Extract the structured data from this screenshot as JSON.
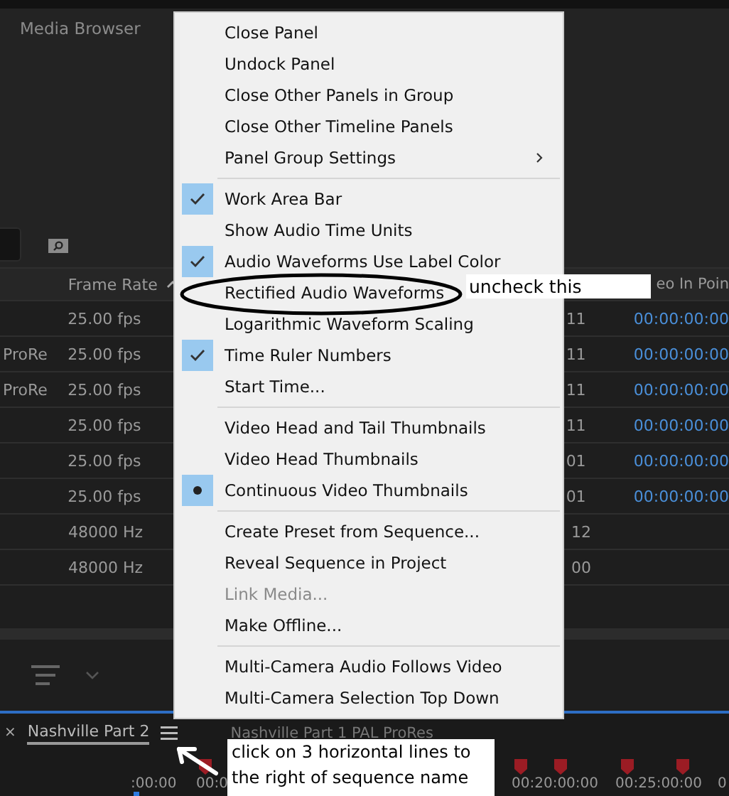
{
  "panel": {
    "title": "Media Browser"
  },
  "table": {
    "headers": {
      "frame_rate": "Frame Rate",
      "column_4": "eo In Poin"
    },
    "rows": [
      {
        "frame_rate": "25.00 fps",
        "column_3": "11",
        "column_4": "00:00:00:00"
      },
      {
        "column_1": "ProRe",
        "frame_rate": "25.00 fps",
        "column_3": "11",
        "column_4": "00:00:00:00"
      },
      {
        "column_1": "ProRe",
        "frame_rate": "25.00 fps",
        "column_3": "11",
        "column_4": "00:00:00:00"
      },
      {
        "frame_rate": "25.00 fps",
        "column_3": "11",
        "column_4": "00:00:00:00"
      },
      {
        "frame_rate": "25.00 fps",
        "column_3": "01",
        "column_4": "00:00:00:00"
      },
      {
        "frame_rate": "25.00 fps",
        "column_3": "01",
        "column_4": "00:00:00:00"
      },
      {
        "frame_rate": "48000 Hz",
        "column_3": "12"
      },
      {
        "frame_rate": "48000 Hz",
        "column_3": "00"
      }
    ]
  },
  "timeline": {
    "tab": {
      "close": "×",
      "title": "Nashville Part 2"
    },
    "sequence_name": "Nashville Part 1 PAL ProRes",
    "ruler": [
      ":00:00",
      "00:0",
      "00:20:00:00",
      "00:25:00:00",
      "0"
    ]
  },
  "menu": {
    "items": [
      {
        "kind": "action",
        "label": "Close Panel",
        "disabled": false
      },
      {
        "kind": "action",
        "label": "Undock Panel",
        "disabled": false
      },
      {
        "kind": "action",
        "label": "Close Other Panels in Group",
        "disabled": false
      },
      {
        "kind": "action",
        "label": "Close Other Timeline Panels",
        "disabled": false
      },
      {
        "kind": "submenu",
        "label": "Panel Group Settings",
        "disabled": false
      },
      {
        "kind": "separator"
      },
      {
        "kind": "check",
        "label": "Work Area Bar",
        "checked": true,
        "disabled": false
      },
      {
        "kind": "check",
        "label": "Show Audio Time Units",
        "checked": false,
        "disabled": false
      },
      {
        "kind": "check",
        "label": "Audio Waveforms Use Label Color",
        "checked": true,
        "disabled": false
      },
      {
        "kind": "check",
        "label": "Rectified Audio Waveforms",
        "checked": false,
        "disabled": false
      },
      {
        "kind": "check",
        "label": "Logarithmic Waveform Scaling",
        "checked": false,
        "disabled": false
      },
      {
        "kind": "check",
        "label": "Time Ruler Numbers",
        "checked": true,
        "disabled": false
      },
      {
        "kind": "action",
        "label": "Start Time...",
        "disabled": false
      },
      {
        "kind": "separator"
      },
      {
        "kind": "radio",
        "label": "Video Head and Tail Thumbnails",
        "selected": false,
        "disabled": false
      },
      {
        "kind": "radio",
        "label": "Video Head Thumbnails",
        "selected": false,
        "disabled": false
      },
      {
        "kind": "radio",
        "label": "Continuous Video Thumbnails",
        "selected": true,
        "disabled": false
      },
      {
        "kind": "separator"
      },
      {
        "kind": "action",
        "label": "Create Preset from Sequence...",
        "disabled": false
      },
      {
        "kind": "action",
        "label": "Reveal Sequence in Project",
        "disabled": false
      },
      {
        "kind": "action",
        "label": "Link Media...",
        "disabled": true
      },
      {
        "kind": "action",
        "label": "Make Offline...",
        "disabled": false
      },
      {
        "kind": "separator"
      },
      {
        "kind": "check",
        "label": "Multi-Camera Audio Follows Video",
        "checked": false,
        "disabled": false
      },
      {
        "kind": "check",
        "label": "Multi-Camera Selection Top Down",
        "checked": false,
        "disabled": false
      }
    ]
  },
  "annotations": [
    {
      "kind": "note",
      "text": "uncheck this"
    },
    {
      "kind": "note",
      "text": "click on 3 horizontal lines to the right of sequence name"
    }
  ]
}
